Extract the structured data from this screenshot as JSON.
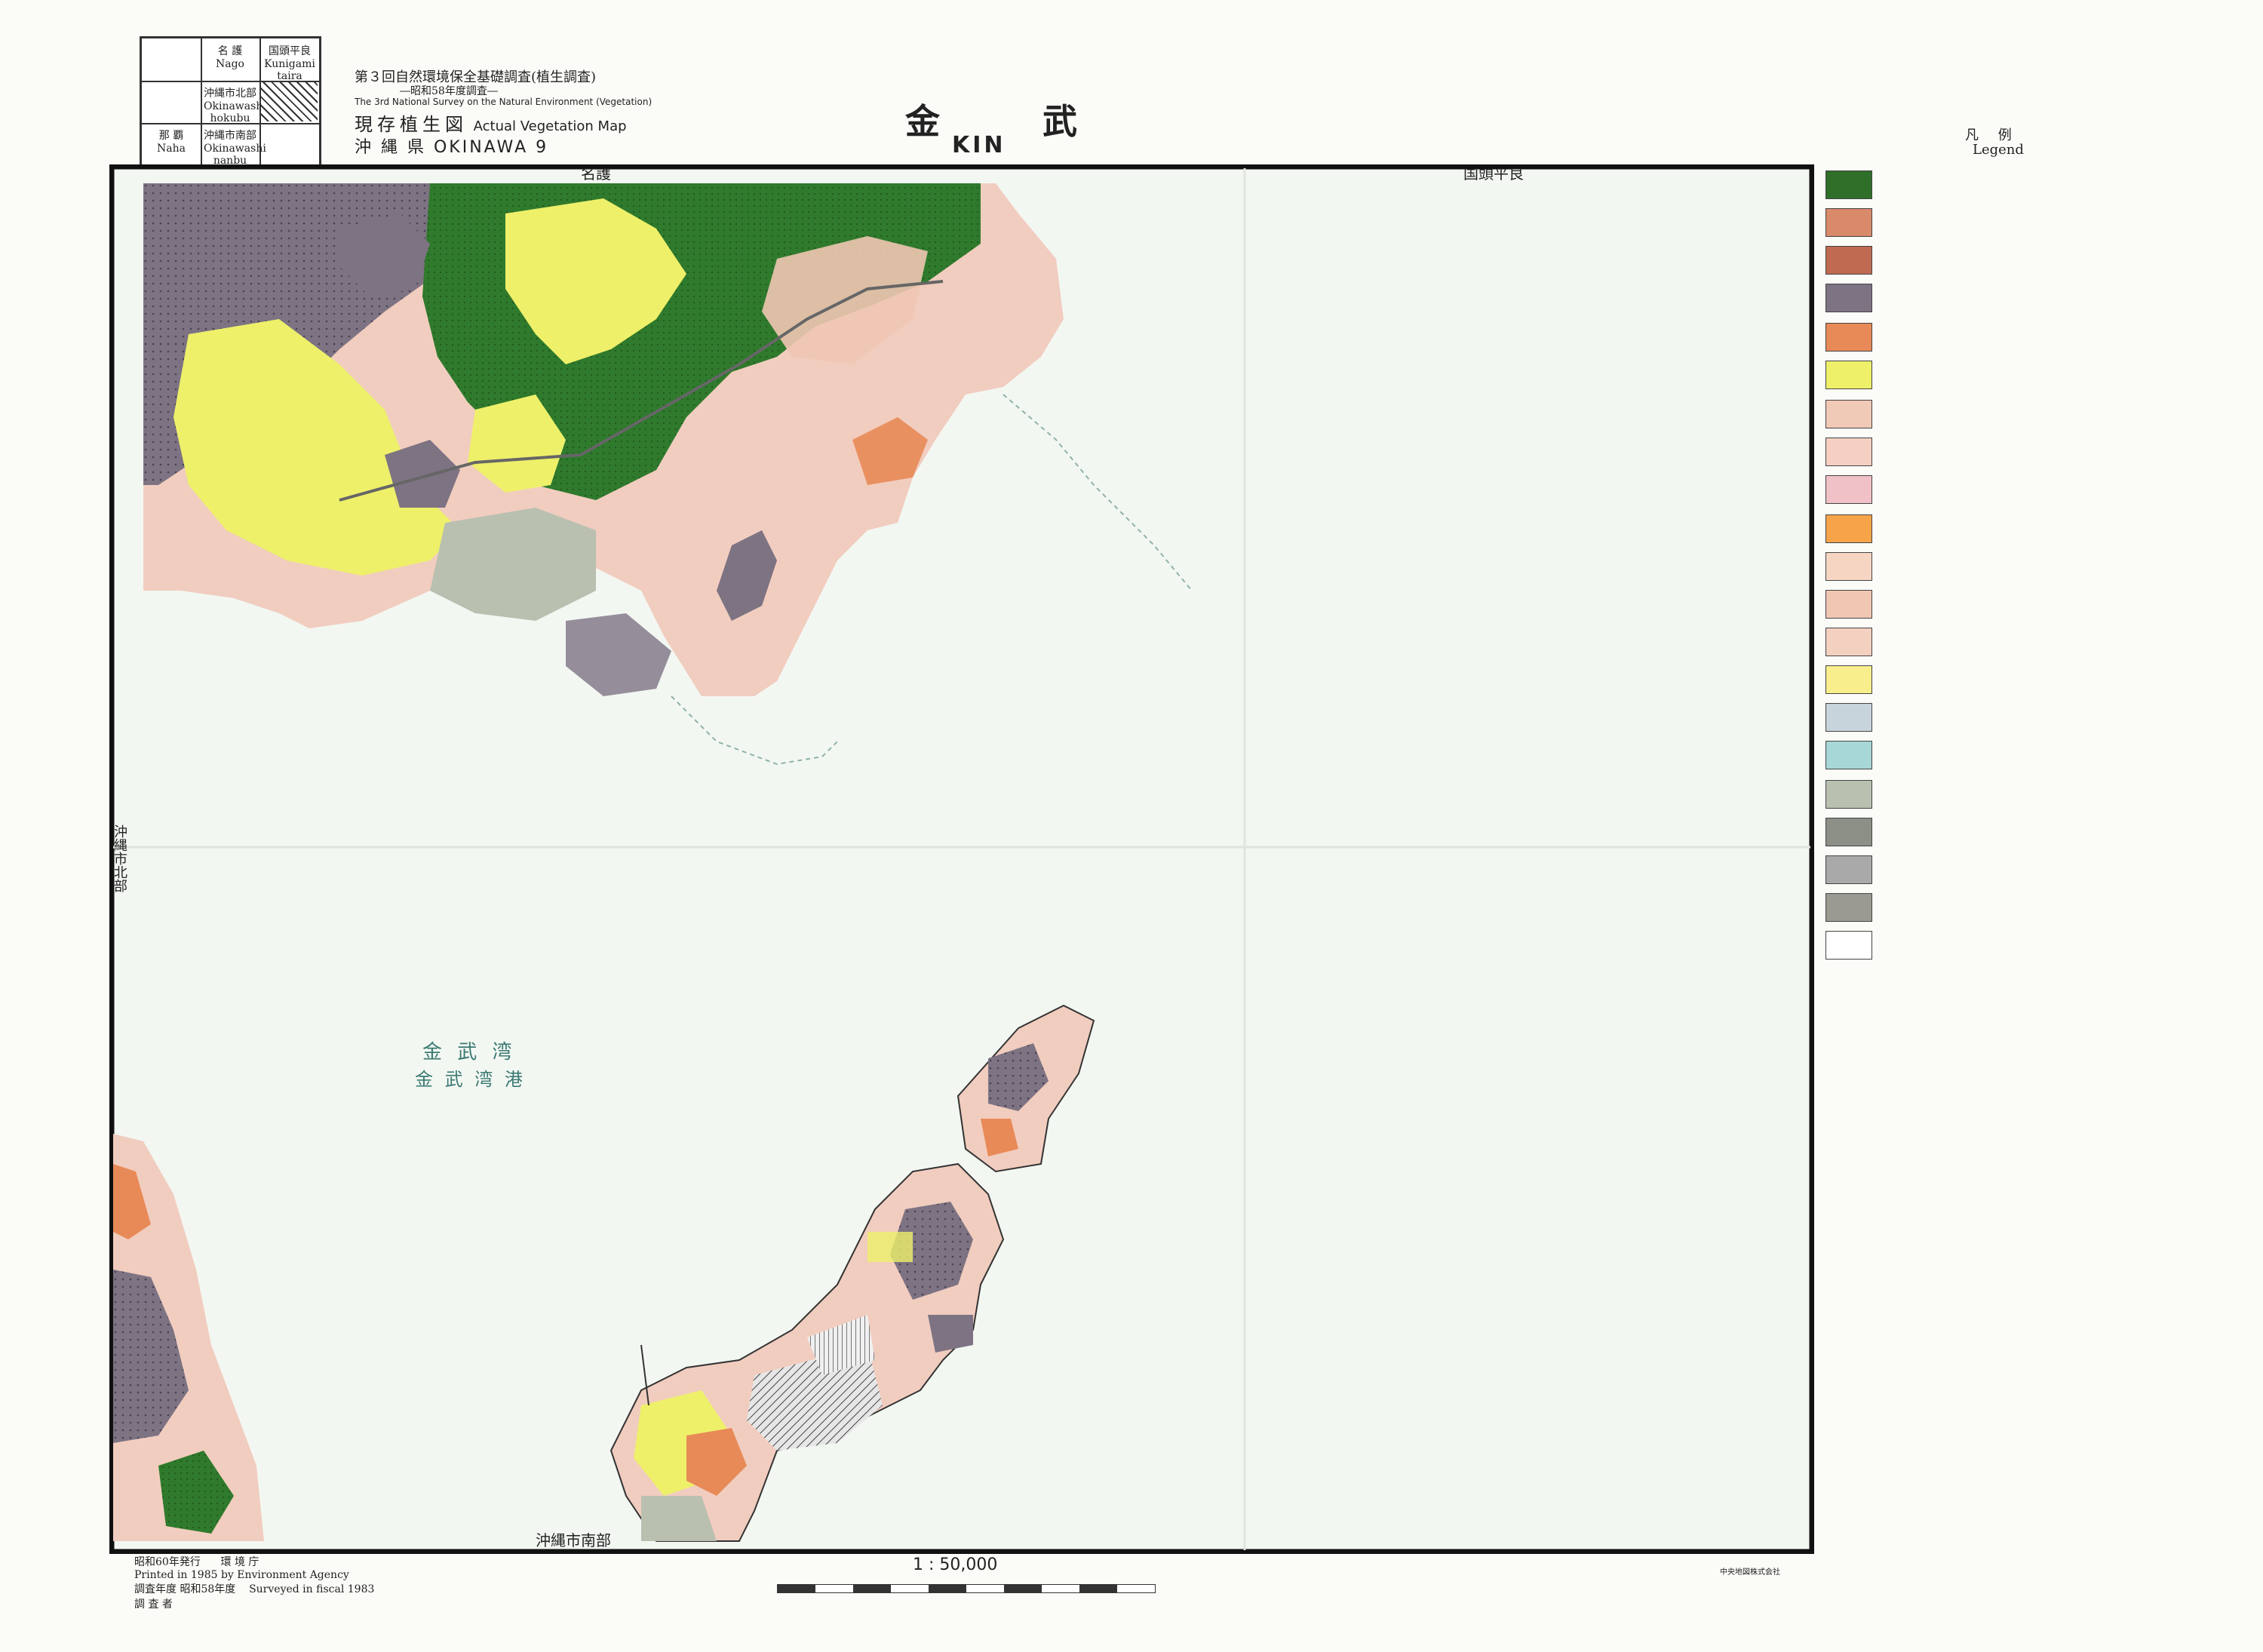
{
  "header": {
    "index_box": {
      "cells": [
        {
          "row": 1,
          "col": 1,
          "jp": "",
          "en": ""
        },
        {
          "row": 1,
          "col": 2,
          "jp": "名 護",
          "en": "Nago"
        },
        {
          "row": 1,
          "col": 3,
          "jp": "国頭平良",
          "en": "Kunigami taira"
        },
        {
          "row": 2,
          "col": 1,
          "jp": "",
          "en": ""
        },
        {
          "row": 2,
          "col": 2,
          "jp": "沖縄市北部",
          "en": "Okinawashi hokubu"
        },
        {
          "row": 3,
          "col": 1,
          "jp": "那 覇",
          "en": "Naha"
        },
        {
          "row": 3,
          "col": 2,
          "jp": "沖縄市南部",
          "en": "Okinawashi nanbu"
        }
      ]
    },
    "survey_title": "第３回自然環境保全基礎調査(植生調査)",
    "survey_year": "―昭和58年度調査―",
    "survey_en": "The 3rd National Survey on the Natural Environment (Vegetation)",
    "map_type_jp": "現存植生図",
    "map_type_en": "Actual Vegetation Map",
    "prefecture": "沖 縄 県 OKINAWA 9",
    "sheet_name_jp": "金 武",
    "sheet_name_en": "KIN",
    "note": "",
    "legend_title_jp": "凡 例",
    "legend_title_en": "Legend"
  },
  "map": {
    "labels": {
      "top_left": "名護",
      "top_right": "国頭平良",
      "bottom": "沖縄市南部",
      "left_upper": "沖縄市北部",
      "bay_1": "金 武 湾",
      "bay_2": "金 武 湾 港"
    }
  },
  "legend": {
    "sections": [
      {
        "title": "",
        "items": [
          {
            "code": "",
            "jp": "",
            "en": "",
            "color": "#2f6f2a"
          },
          {
            "code": "",
            "jp": "",
            "en": "",
            "color": "#d98a6a"
          },
          {
            "code": "",
            "jp": "",
            "en": "",
            "color": "#c06a52"
          },
          {
            "code": "",
            "jp": "",
            "en": "",
            "color": "#7d7383"
          }
        ]
      },
      {
        "title": "",
        "items": [
          {
            "code": "",
            "jp": "",
            "en": "",
            "color": "#e88a57"
          },
          {
            "code": "",
            "jp": "",
            "en": "",
            "color": "#eef06a"
          }
        ]
      },
      {
        "title": "",
        "items": [
          {
            "code": "",
            "jp": "",
            "en": "",
            "color": "#f1c9b7"
          },
          {
            "code": "",
            "jp": "",
            "en": "",
            "color": "#f4cfc2"
          },
          {
            "code": "",
            "jp": "",
            "en": "",
            "color": "#f0c1c7"
          }
        ]
      },
      {
        "title": "",
        "items": [
          {
            "code": "",
            "jp": "",
            "en": "",
            "color": "#f6a34a"
          },
          {
            "code": "",
            "jp": "",
            "en": "",
            "color": "#f6d6c3"
          },
          {
            "code": "",
            "jp": "",
            "en": "",
            "color": "#f0c7b3"
          },
          {
            "code": "",
            "jp": "",
            "en": "",
            "color": "#f4d0c0"
          },
          {
            "code": "",
            "jp": "",
            "en": "",
            "color": "#f8ee8c"
          },
          {
            "code": "",
            "jp": "",
            "en": "",
            "color": "#c8d4db"
          },
          {
            "code": "",
            "jp": "",
            "en": "",
            "color": "#a7d7d6"
          }
        ]
      },
      {
        "title": "",
        "items": [
          {
            "code": "",
            "jp": "",
            "en": "",
            "color": "#b9c0b0"
          },
          {
            "code": "",
            "jp": "",
            "en": "",
            "color": "#8c8f86"
          },
          {
            "code": "",
            "jp": "",
            "en": "",
            "color": "#a9a9a9"
          },
          {
            "code": "",
            "jp": "",
            "en": "",
            "color": "#9a9a92"
          },
          {
            "code": "",
            "jp": "",
            "en": "",
            "color": "#ffffff"
          }
        ]
      }
    ],
    "footnotes": []
  },
  "footer": {
    "published": "昭和60年発行",
    "publisher_jp": "環 境 庁",
    "printed": "Printed in 1985 by",
    "publisher_en": "Environment Agency",
    "surveyed_jp": "調査年度 昭和58年度",
    "surveyed_en": "Surveyed in fiscal 1983",
    "surveyor": "調 査 者",
    "scale": "1 : 50,000",
    "printer": "中央地図株式会社"
  }
}
